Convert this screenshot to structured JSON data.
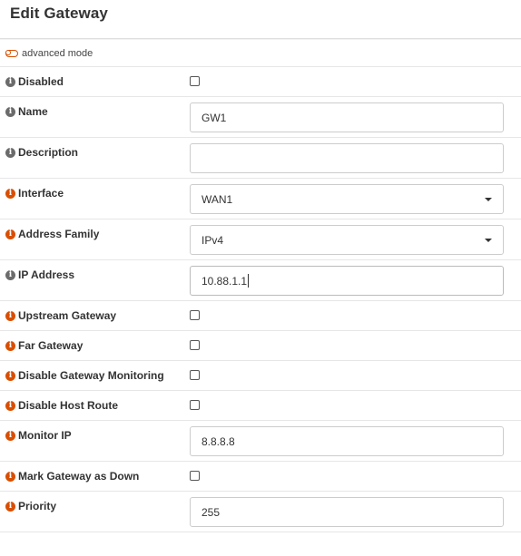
{
  "header": {
    "title": "Edit Gateway"
  },
  "advanced_mode": {
    "label": "advanced mode"
  },
  "fields": {
    "disabled": {
      "label": "Disabled"
    },
    "name": {
      "label": "Name",
      "value": "GW1"
    },
    "description": {
      "label": "Description",
      "value": ""
    },
    "interface": {
      "label": "Interface",
      "value": "WAN1"
    },
    "address_family": {
      "label": "Address Family",
      "value": "IPv4"
    },
    "ip_address": {
      "label": "IP Address",
      "value": "10.88.1.1"
    },
    "upstream_gateway": {
      "label": "Upstream Gateway"
    },
    "far_gateway": {
      "label": "Far Gateway"
    },
    "disable_monitoring": {
      "label": "Disable Gateway Monitoring"
    },
    "disable_host_route": {
      "label": "Disable Host Route"
    },
    "monitor_ip": {
      "label": "Monitor IP",
      "value": "8.8.8.8"
    },
    "mark_down": {
      "label": "Mark Gateway as Down"
    },
    "priority": {
      "label": "Priority",
      "value": "255"
    }
  },
  "icons": {
    "info": "info-circle-icon",
    "toggle": "toggle-off-icon"
  },
  "colors": {
    "info_gray": "#6b6b6b",
    "info_required": "#d94f00",
    "toggle": "#d94f00"
  }
}
